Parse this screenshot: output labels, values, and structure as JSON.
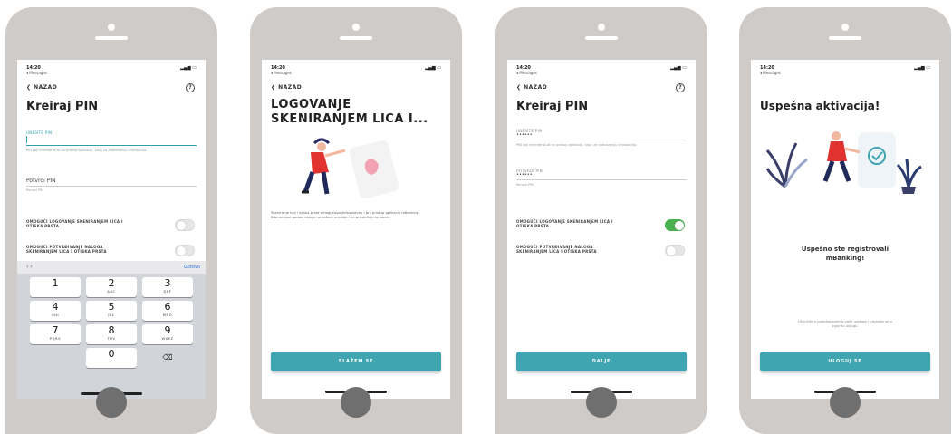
{
  "status": {
    "time": "14:20",
    "messages": "◂ Messages",
    "signal": "▂▄▆ ▭"
  },
  "screens": [
    {
      "back": "❮ NAZAD",
      "help": "?",
      "title": "Kreiraj PIN",
      "field1_label": "UNESITE PIN",
      "field1_hint": "PIN koji kreirate služi za pristup aplikaciji, kao i za autorizaciju transakcija.",
      "field2_value": "Potvrdi PIN",
      "field2_hint": "Ponovi PIN",
      "toggle1": "OMOGUĆI LOGOVANJE SKENIRANJEM LICA I OTISKA PRSTA",
      "toggle2": "OMOGUĆI POTVRĐIVANJE NALOGA SKENIRANJEM LICA I OTISKA PRSTA",
      "kb_arrows": "‹  ›",
      "kb_done": "Gotovo",
      "keys": [
        {
          "n": "1",
          "l": ""
        },
        {
          "n": "2",
          "l": "ABC"
        },
        {
          "n": "3",
          "l": "DEF"
        },
        {
          "n": "4",
          "l": "GHI"
        },
        {
          "n": "5",
          "l": "JKL"
        },
        {
          "n": "6",
          "l": "MNO"
        },
        {
          "n": "7",
          "l": "PQRS"
        },
        {
          "n": "8",
          "l": "TUV"
        },
        {
          "n": "9",
          "l": "WXYZ"
        },
        {
          "n": "0",
          "l": ""
        },
        {
          "n": "⌫",
          "l": ""
        }
      ]
    },
    {
      "status_time": "14:20",
      "back": "❮ NAZAD",
      "title_line1": "LOGOVANJE",
      "title_line2": "SKENIRANJEM LICA I...",
      "paragraph": "Skeniranje lica i otiska prsta omogućava jednostavan i brz pristup aplikaciji mBanking. Biometrijski podaci ostaju na vašem uređaju i ne prosleđuju se banci.",
      "button": "SLAŽEM SE"
    },
    {
      "back": "❮ NAZAD",
      "help": "?",
      "title": "Kreiraj PIN",
      "field1_label": "UNESITE PIN",
      "field1_dots": "••••••",
      "field1_hint": "PIN koji kreirate služi za pristup aplikaciji, kao i za autorizaciju transakcija.",
      "field2_label": "POTVRDI PIN",
      "field2_dots": "••••••",
      "field2_hint": "Ponovi PIN",
      "toggle1": "OMOGUĆI LOGOVANJE SKENIRANJEM LICA I OTISKA PRSTA",
      "toggle2": "OMOGUĆI POTVRĐIVANJE NALOGA SKENIRANJEM LICA I OTISKA PRSTA",
      "button": "DALJE"
    },
    {
      "title": "Uspešna aktivacija!",
      "message": "Uspešno ste registrovali mBanking!",
      "paragraph": "Uključite u podešavanjima vaše uređaja i prijavite se u sigurnu uslugu.",
      "button": "ULOGUJ SE"
    }
  ]
}
